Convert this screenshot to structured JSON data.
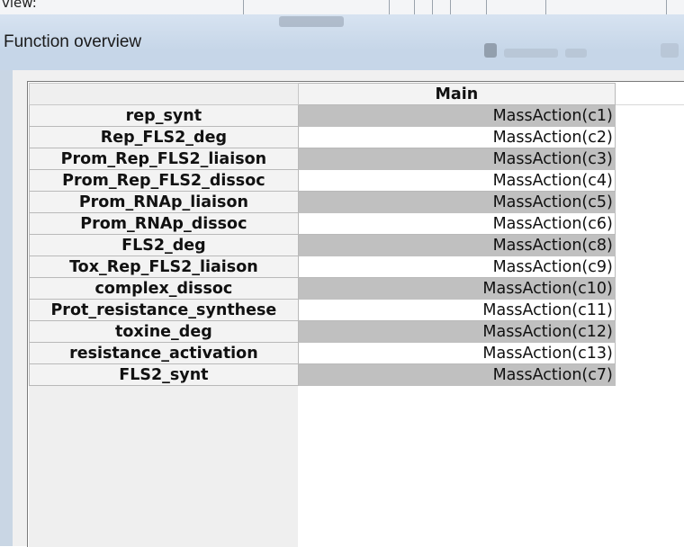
{
  "background_window": {
    "partial_label": "view:"
  },
  "dialog": {
    "title": "Function overview"
  },
  "grid": {
    "column_header": "Main",
    "rows": [
      {
        "name": "rep_synt",
        "function": "MassAction(c1)"
      },
      {
        "name": "Rep_FLS2_deg",
        "function": "MassAction(c2)"
      },
      {
        "name": "Prom_Rep_FLS2_liaison",
        "function": "MassAction(c3)"
      },
      {
        "name": "Prom_Rep_FLS2_dissoc",
        "function": "MassAction(c4)"
      },
      {
        "name": "Prom_RNAp_liaison",
        "function": "MassAction(c5)"
      },
      {
        "name": "Prom_RNAp_dissoc",
        "function": "MassAction(c6)"
      },
      {
        "name": "FLS2_deg",
        "function": "MassAction(c8)"
      },
      {
        "name": "Tox_Rep_FLS2_liaison",
        "function": "MassAction(c9)"
      },
      {
        "name": "complex_dissoc",
        "function": "MassAction(c10)"
      },
      {
        "name": "Prot_resistance_synthese",
        "function": "MassAction(c11)"
      },
      {
        "name": "toxine_deg",
        "function": "MassAction(c12)"
      },
      {
        "name": "resistance_activation",
        "function": "MassAction(c13)"
      },
      {
        "name": "FLS2_synt",
        "function": "MassAction(c7)"
      }
    ]
  },
  "colors": {
    "shaded_cell": "#c0c0c0",
    "title_bar": "#c6d6e8"
  }
}
